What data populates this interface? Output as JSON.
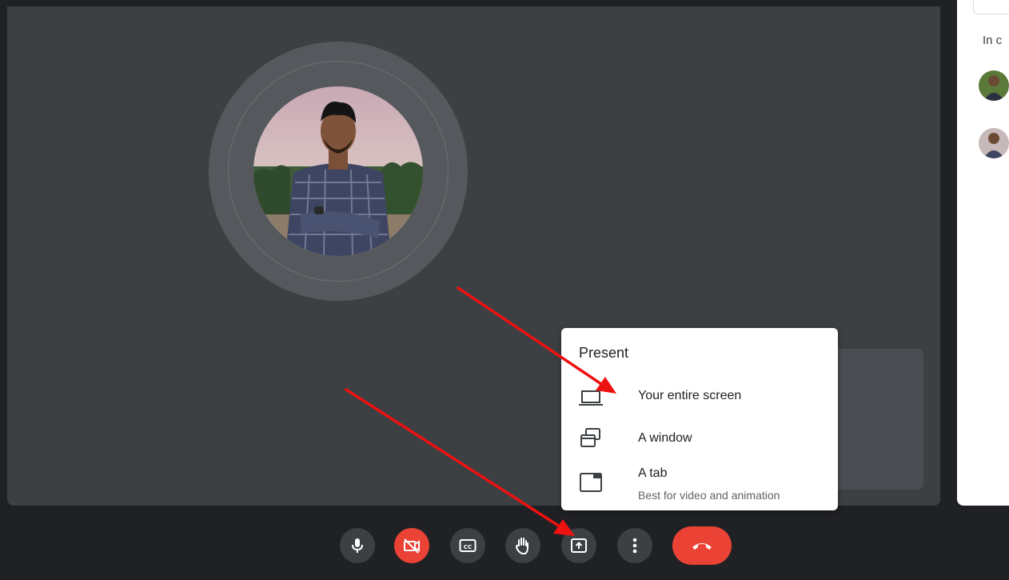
{
  "side_panel": {
    "section_label": "In c"
  },
  "present_menu": {
    "title": "Present",
    "items": [
      {
        "label": "Your entire screen",
        "icon": "laptop-icon"
      },
      {
        "label": "A window",
        "icon": "window-icon"
      },
      {
        "label": "A tab",
        "sublabel": "Best for video and animation",
        "icon": "tab-icon"
      }
    ]
  },
  "controls": [
    {
      "name": "microphone",
      "icon": "mic-icon"
    },
    {
      "name": "camera-off",
      "icon": "camera-off-icon",
      "color": "#ea4335"
    },
    {
      "name": "captions",
      "icon": "cc-icon"
    },
    {
      "name": "raise-hand",
      "icon": "hand-icon"
    },
    {
      "name": "present-now",
      "icon": "present-icon"
    },
    {
      "name": "more-options",
      "icon": "more-vert-icon"
    },
    {
      "name": "leave-call",
      "icon": "hangup-icon",
      "color": "#ea4335"
    }
  ],
  "colors": {
    "stage": "#3c4043",
    "toolbar": "#202124",
    "danger": "#ea4335",
    "annotation": "#ee1111"
  }
}
